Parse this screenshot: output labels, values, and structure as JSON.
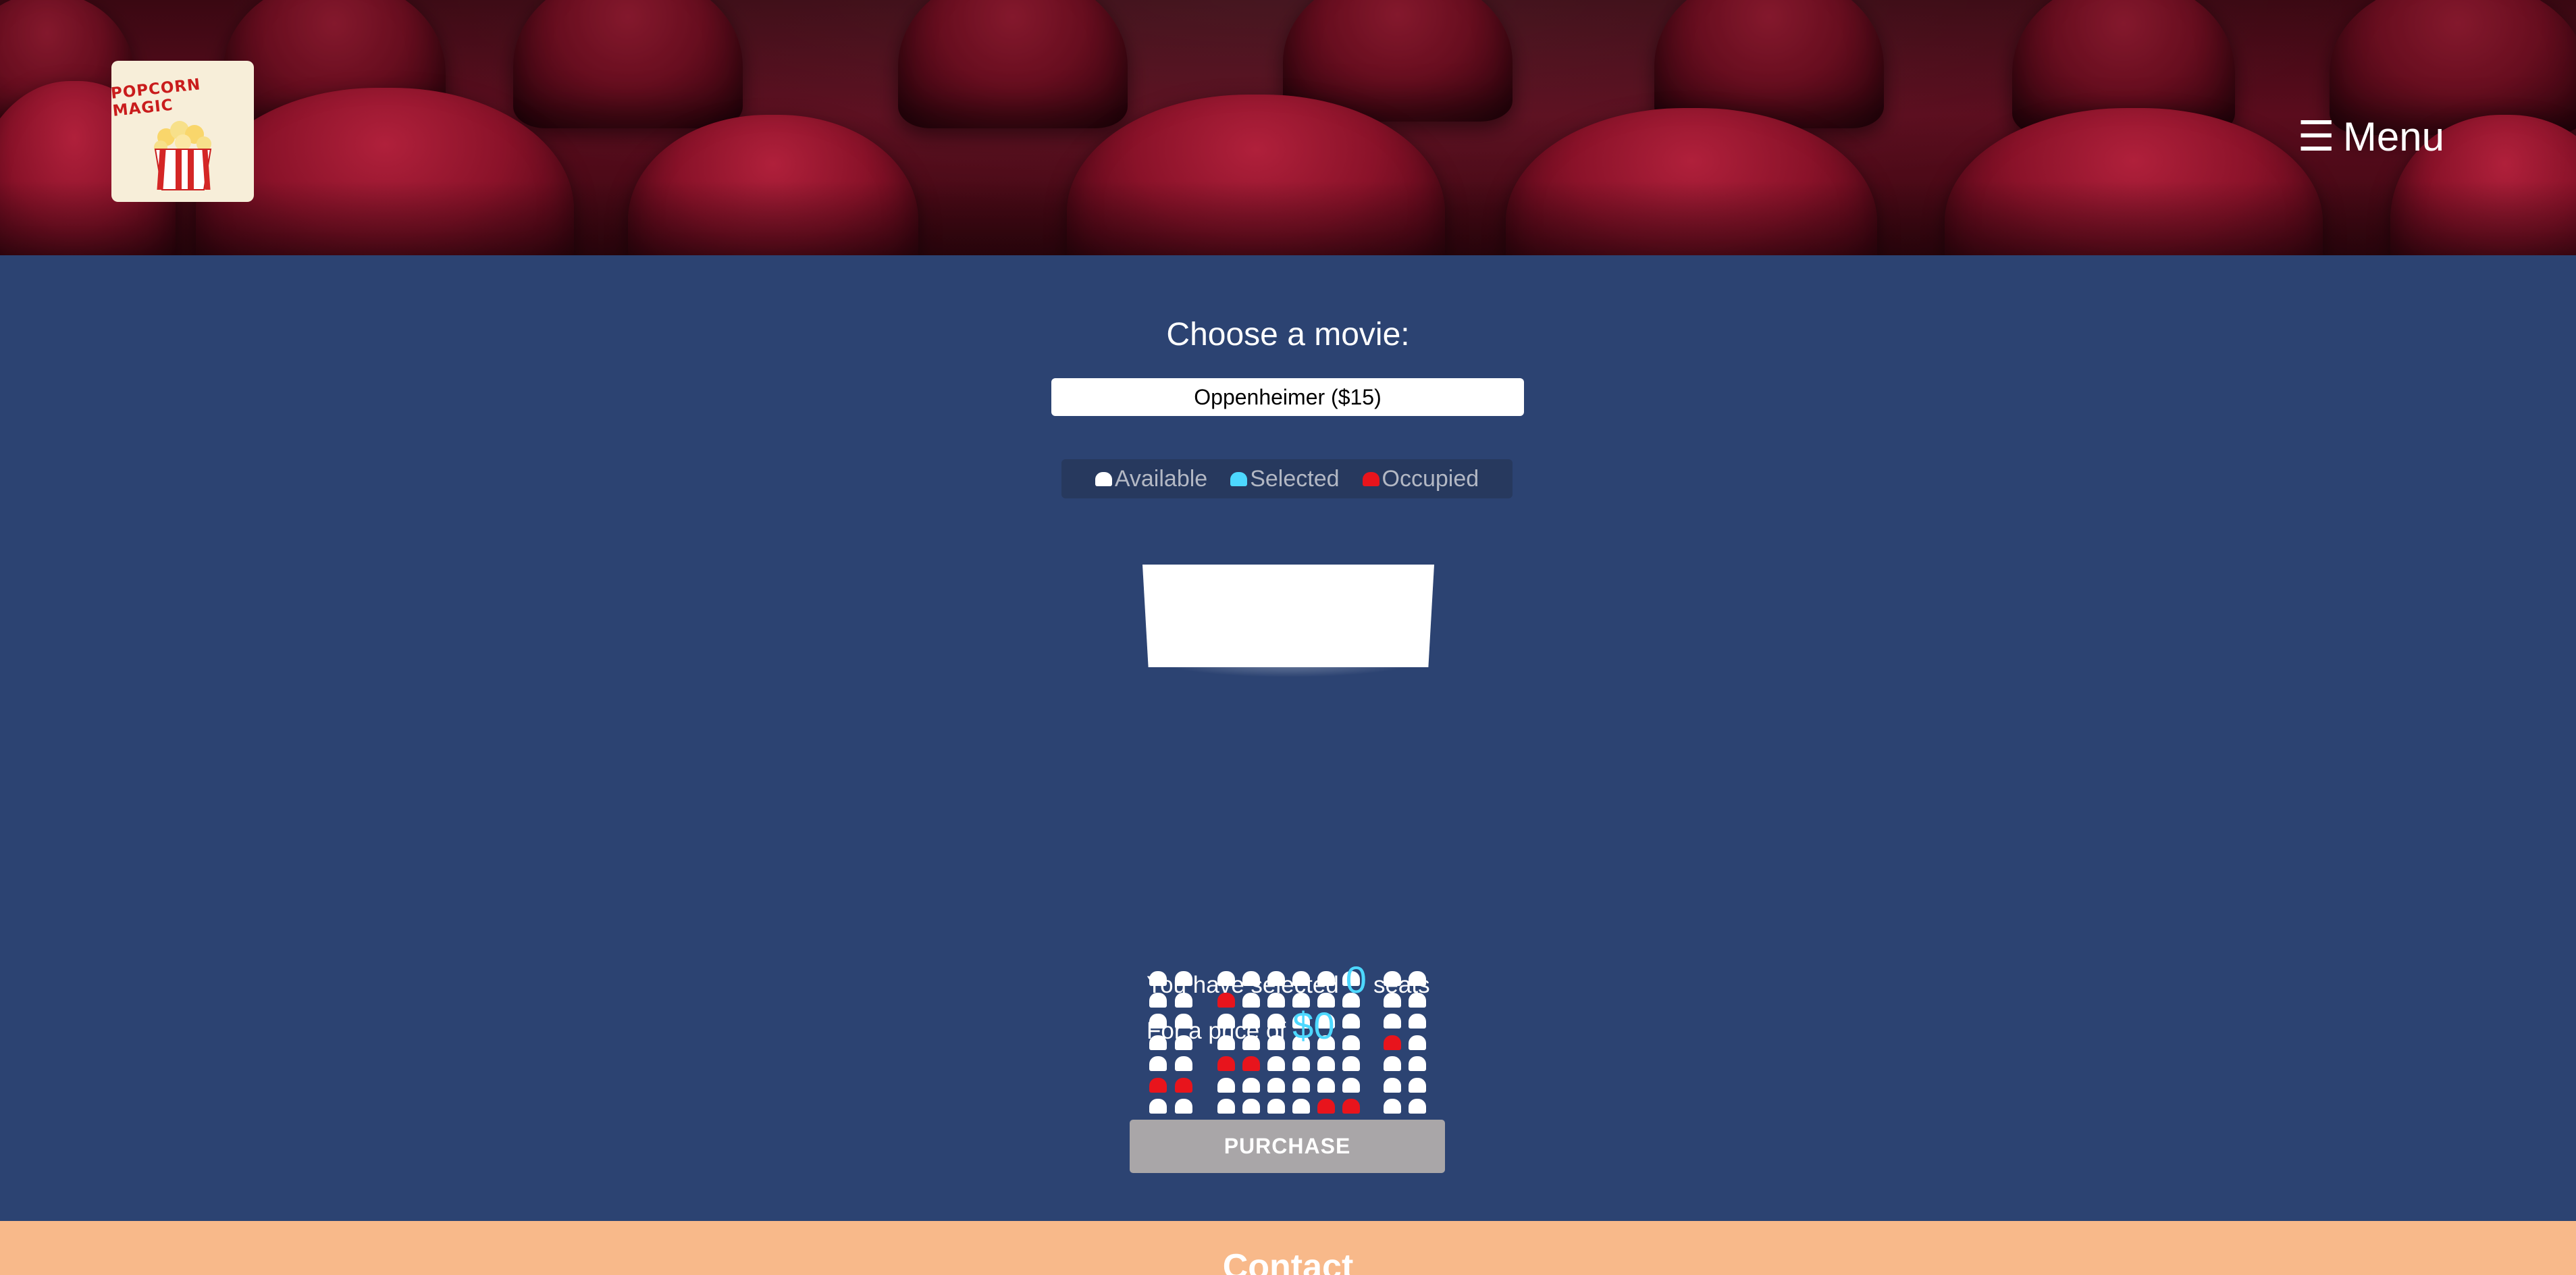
{
  "header": {
    "logo_text": "POPCORN MAGIC",
    "menu_icon": "☰",
    "menu_label": "Menu"
  },
  "main": {
    "choose_label": "Choose a movie:",
    "selected_movie": "Oppenheimer ($15)",
    "legend": [
      {
        "label": "Available",
        "color": "#ffffff"
      },
      {
        "label": "Selected",
        "color": "#4dd8ff"
      },
      {
        "label": "Occupied",
        "color": "#e8141c"
      }
    ],
    "seating": {
      "rows": 8,
      "sections": [
        2,
        6,
        2
      ],
      "occupied": [
        [
          1,
          2
        ],
        [
          4,
          2
        ],
        [
          4,
          3
        ],
        [
          5,
          0
        ],
        [
          5,
          1
        ],
        [
          6,
          6
        ],
        [
          6,
          7
        ],
        [
          3,
          8
        ],
        [
          7,
          8
        ],
        [
          7,
          9
        ]
      ],
      "available_color": "#ffffff",
      "occupied_color": "#e8141c"
    },
    "summary": {
      "prefix": "You have selected",
      "seat_count": "0",
      "seats_word": "seats",
      "price_prefix": "For a price of",
      "price": "$0"
    },
    "purchase_label": "PURCHASE"
  },
  "footer": {
    "title": "Contact"
  }
}
